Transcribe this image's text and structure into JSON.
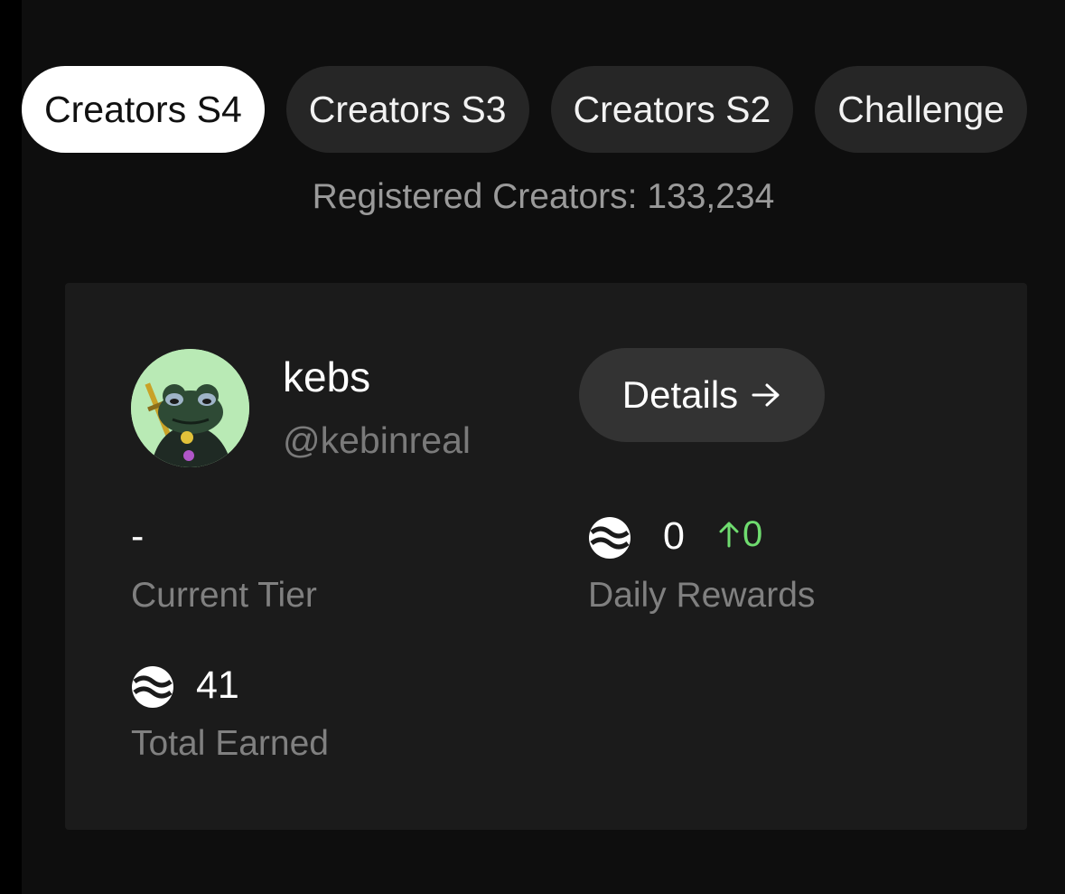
{
  "tabs": [
    {
      "label": "Creators S4",
      "active": true
    },
    {
      "label": "Creators S3",
      "active": false
    },
    {
      "label": "Creators S2",
      "active": false
    },
    {
      "label": "Challenge",
      "active": false
    }
  ],
  "registered_text": "Registered Creators: 133,234",
  "profile": {
    "name": "kebs",
    "handle": "@kebinreal",
    "avatar": "frog-avatar"
  },
  "details_button": {
    "label": "Details",
    "icon": "arrow-right-icon"
  },
  "stats": {
    "current_tier": {
      "value": "-",
      "label": "Current Tier"
    },
    "daily_rewards": {
      "value": "0",
      "delta": "0",
      "delta_icon": "arrow-up-icon",
      "label": "Daily Rewards",
      "icon": "coin-icon"
    },
    "total_earned": {
      "value": "41",
      "label": "Total Earned",
      "icon": "coin-icon"
    }
  },
  "colors": {
    "background": "#0e0e0e",
    "card": "#1b1b1b",
    "tab": "#262626",
    "tab_active": "#ffffff",
    "positive": "#6fdc6f"
  }
}
